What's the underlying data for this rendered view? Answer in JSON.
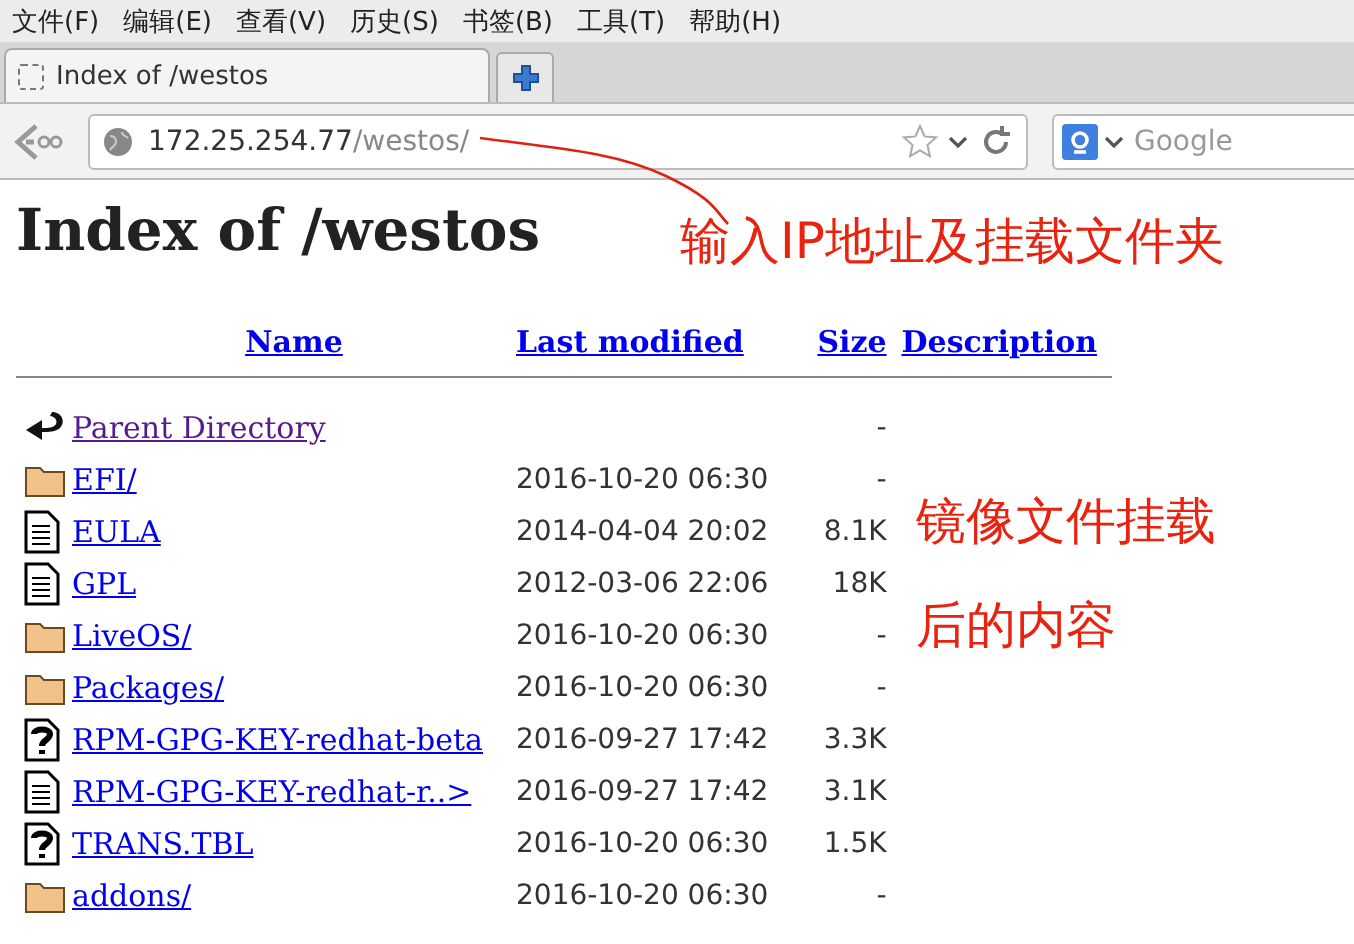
{
  "menu": [
    "文件(F)",
    "编辑(E)",
    "查看(V)",
    "历史(S)",
    "书签(B)",
    "工具(T)",
    "帮助(H)"
  ],
  "tab": {
    "title": "Index of /westos",
    "selected": true
  },
  "address": {
    "host": "172.25.254.77",
    "path": "/westos/"
  },
  "search": {
    "placeholder": "Google"
  },
  "heading": "Index of /westos",
  "columns": [
    "Name",
    "Last modified",
    "Size",
    "Description"
  ],
  "rows": [
    {
      "kind": "back",
      "name": "Parent Directory",
      "visited": true,
      "modified": "",
      "size": "-"
    },
    {
      "kind": "folder",
      "name": "EFI/",
      "visited": false,
      "modified": "2016-10-20 06:30",
      "size": "-"
    },
    {
      "kind": "text",
      "name": "EULA",
      "visited": false,
      "modified": "2014-04-04 20:02",
      "size": "8.1K"
    },
    {
      "kind": "text",
      "name": "GPL",
      "visited": false,
      "modified": "2012-03-06 22:06",
      "size": "18K"
    },
    {
      "kind": "folder",
      "name": "LiveOS/",
      "visited": false,
      "modified": "2016-10-20 06:30",
      "size": "-"
    },
    {
      "kind": "folder",
      "name": "Packages/",
      "visited": false,
      "modified": "2016-10-20 06:30",
      "size": "-"
    },
    {
      "kind": "unknown",
      "name": "RPM-GPG-KEY-redhat-beta",
      "visited": false,
      "modified": "2016-09-27 17:42",
      "size": "3.3K"
    },
    {
      "kind": "text",
      "name": "RPM-GPG-KEY-redhat-r..>",
      "visited": false,
      "modified": "2016-09-27 17:42",
      "size": "3.1K"
    },
    {
      "kind": "unknown",
      "name": "TRANS.TBL",
      "visited": false,
      "modified": "2016-10-20 06:30",
      "size": "1.5K"
    },
    {
      "kind": "folder",
      "name": "addons/",
      "visited": false,
      "modified": "2016-10-20 06:30",
      "size": "-"
    }
  ],
  "annotations": [
    "输入IP地址及挂载文件夹",
    "镜像文件挂载",
    "后的内容"
  ]
}
